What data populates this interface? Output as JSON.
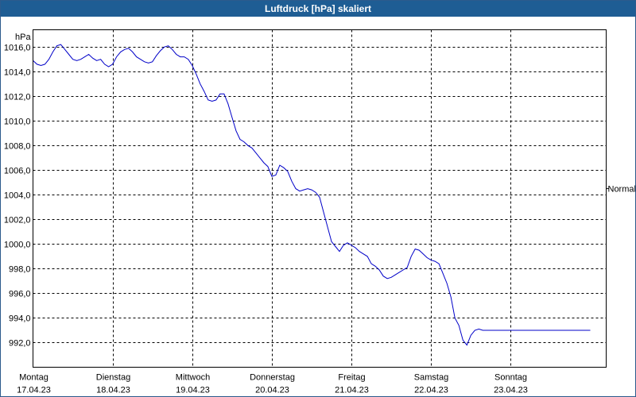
{
  "chart_data": {
    "type": "line",
    "title": "Luftdruck [hPa] skaliert",
    "ylabel": "hPa",
    "ylim": [
      990.0,
      1017.4
    ],
    "yticks": [
      992,
      994,
      996,
      998,
      1000,
      1002,
      1004,
      1006,
      1008,
      1010,
      1012,
      1014,
      1016
    ],
    "ytick_labels": [
      "992,0",
      "994,0",
      "996,0",
      "998,0",
      "1000,0",
      "1002,0",
      "1004,0",
      "1006,0",
      "1008,0",
      "1010,0",
      "1012,0",
      "1014,0",
      "1016,0"
    ],
    "xlim": [
      0,
      7.2
    ],
    "x_ticks": [
      {
        "x": 0,
        "day": "Montag",
        "date": "17.04.23"
      },
      {
        "x": 1,
        "day": "Dienstag",
        "date": "18.04.23"
      },
      {
        "x": 2,
        "day": "Mittwoch",
        "date": "19.04.23"
      },
      {
        "x": 3,
        "day": "Donnerstag",
        "date": "20.04.23"
      },
      {
        "x": 4,
        "day": "Freitag",
        "date": "21.04.23"
      },
      {
        "x": 5,
        "day": "Samstag",
        "date": "22.04.23"
      },
      {
        "x": 6,
        "day": "Sonntag",
        "date": "23.04.23"
      }
    ],
    "reference_label": "Normal",
    "reference_value": 1004.5,
    "grid": true,
    "series": [
      {
        "color": "#0000c8",
        "x": [
          0.0,
          0.05,
          0.1,
          0.15,
          0.2,
          0.25,
          0.3,
          0.35,
          0.4,
          0.45,
          0.5,
          0.55,
          0.6,
          0.65,
          0.7,
          0.75,
          0.8,
          0.85,
          0.9,
          0.95,
          1.0,
          1.05,
          1.1,
          1.15,
          1.2,
          1.25,
          1.3,
          1.35,
          1.4,
          1.45,
          1.5,
          1.55,
          1.6,
          1.65,
          1.7,
          1.75,
          1.8,
          1.85,
          1.9,
          1.95,
          2.0,
          2.05,
          2.1,
          2.15,
          2.2,
          2.25,
          2.3,
          2.35,
          2.4,
          2.45,
          2.5,
          2.55,
          2.6,
          2.65,
          2.7,
          2.75,
          2.8,
          2.85,
          2.9,
          2.95,
          3.0,
          3.05,
          3.1,
          3.15,
          3.2,
          3.25,
          3.3,
          3.35,
          3.4,
          3.45,
          3.5,
          3.55,
          3.6,
          3.65,
          3.7,
          3.75,
          3.8,
          3.85,
          3.9,
          3.95,
          4.0,
          4.05,
          4.1,
          4.15,
          4.2,
          4.25,
          4.3,
          4.35,
          4.4,
          4.45,
          4.5,
          4.55,
          4.6,
          4.65,
          4.7,
          4.75,
          4.8,
          4.85,
          4.9,
          4.95,
          5.0,
          5.05,
          5.1,
          5.15,
          5.2,
          5.25,
          5.3,
          5.35,
          5.4,
          5.45,
          5.5,
          5.55,
          5.6,
          5.65,
          5.7,
          5.75,
          5.8,
          5.85,
          5.9,
          5.95,
          6.0,
          6.05,
          6.1,
          6.15,
          6.2,
          6.25,
          6.3,
          6.35,
          6.4,
          6.45,
          6.5,
          6.55,
          6.6,
          6.65,
          6.7,
          6.75,
          6.8,
          6.85,
          6.9,
          6.95,
          7.0
        ],
        "y": [
          1014.9,
          1014.6,
          1014.5,
          1014.6,
          1015.0,
          1015.6,
          1016.1,
          1016.2,
          1015.8,
          1015.4,
          1015.0,
          1014.9,
          1015.0,
          1015.2,
          1015.4,
          1015.1,
          1014.9,
          1015.0,
          1014.6,
          1014.4,
          1014.6,
          1015.2,
          1015.6,
          1015.8,
          1015.9,
          1015.6,
          1015.2,
          1015.0,
          1014.8,
          1014.7,
          1014.8,
          1015.3,
          1015.7,
          1016.0,
          1016.1,
          1015.8,
          1015.4,
          1015.2,
          1015.2,
          1015.0,
          1014.5,
          1013.8,
          1013.0,
          1012.4,
          1011.7,
          1011.6,
          1011.7,
          1012.2,
          1012.2,
          1011.4,
          1010.3,
          1009.2,
          1008.5,
          1008.3,
          1008.0,
          1007.8,
          1007.4,
          1007.0,
          1006.6,
          1006.3,
          1005.5,
          1005.6,
          1006.4,
          1006.2,
          1005.9,
          1005.1,
          1004.5,
          1004.3,
          1004.4,
          1004.5,
          1004.4,
          1004.2,
          1003.8,
          1002.6,
          1001.4,
          1000.2,
          999.8,
          999.4,
          999.9,
          1000.1,
          999.9,
          999.7,
          999.4,
          999.2,
          999.0,
          998.4,
          998.2,
          997.9,
          997.4,
          997.2,
          997.3,
          997.5,
          997.7,
          997.9,
          998.1,
          999.0,
          999.6,
          999.5,
          999.2,
          998.9,
          998.7,
          998.6,
          998.4,
          997.6,
          996.8,
          995.7,
          994.0,
          993.4,
          992.2,
          991.8,
          992.6,
          993.0,
          993.1,
          993.0,
          993.0,
          993.0,
          993.0,
          993.0,
          993.0,
          993.0,
          993.0,
          993.0,
          993.0,
          993.0,
          993.0,
          993.0,
          993.0,
          993.0,
          993.0,
          993.0,
          993.0,
          993.0,
          993.0,
          993.0,
          993.0,
          993.0,
          993.0,
          993.0,
          993.0,
          993.0,
          993.0
        ]
      }
    ]
  }
}
